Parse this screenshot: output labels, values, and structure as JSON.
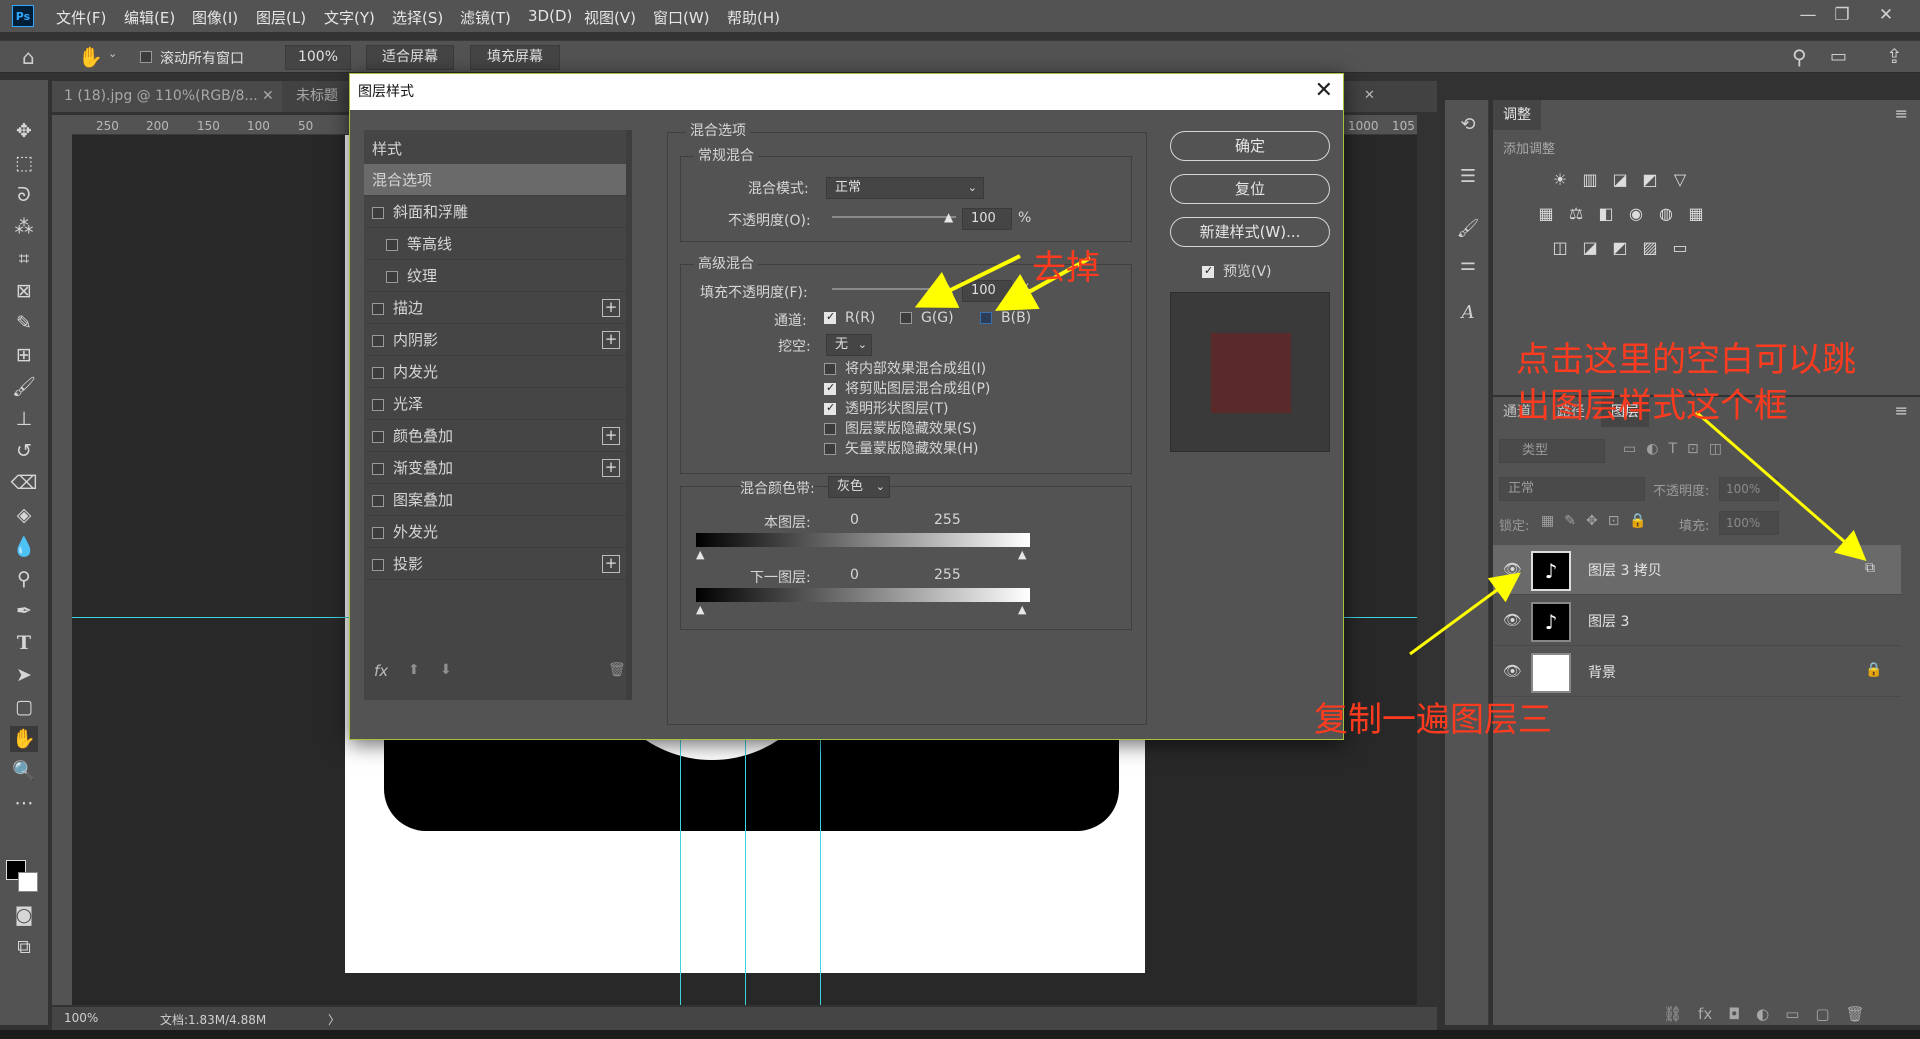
{
  "menubar": {
    "logo": "Ps",
    "items": [
      "文件(F)",
      "编辑(E)",
      "图像(I)",
      "图层(L)",
      "文字(Y)",
      "选择(S)",
      "滤镜(T)",
      "3D(D)",
      "视图(V)",
      "窗口(W)",
      "帮助(H)"
    ],
    "window_buttons": [
      "—",
      "❐",
      "✕"
    ]
  },
  "options": {
    "scroll_all_label": "滚动所有窗口",
    "zoom_value": "100%",
    "fit_screen": "适合屏幕",
    "fill_screen": "填充屏幕"
  },
  "doc_tabs": [
    {
      "label": "1 (18).jpg @ 110%(RGB/8...",
      "close": "✕"
    },
    {
      "label": "未标题",
      "close": ""
    }
  ],
  "doc_tab_extra_close": "✕",
  "ruler": {
    "h_ticks": [
      "250",
      "200",
      "150",
      "100",
      "50",
      "1000",
      "105"
    ]
  },
  "status": {
    "zoom": "100%",
    "doc_info": "文档:1.83M/4.88M",
    "arrow": "〉"
  },
  "adjust_panel": {
    "tab": "调整",
    "add_label": "添加调整",
    "icons_row1": [
      "☀",
      "▥",
      "◪",
      "◩",
      "▽"
    ],
    "icons_row2": [
      "▦",
      "⚖",
      "◧",
      "◉",
      "◍",
      "▦"
    ],
    "icons_row3": [
      "◫",
      "◪",
      "◩",
      "▨",
      "▭"
    ]
  },
  "layers_panel": {
    "tabs": [
      "通道",
      "路径",
      "图层"
    ],
    "filter_type": "类型",
    "blend_mode": "正常",
    "opacity_label": "不透明度:",
    "opacity_value": "100%",
    "lock_label": "锁定:",
    "fill_label": "填充:",
    "fill_value": "100%",
    "layers": [
      {
        "name": "图层 3 拷贝",
        "selected": true,
        "thumb": "tiktok"
      },
      {
        "name": "图层 3",
        "selected": false,
        "thumb": "tiktok"
      },
      {
        "name": "背景",
        "selected": false,
        "thumb": "white"
      }
    ],
    "footer_icons": [
      "⛓",
      "fx",
      "◘",
      "◐",
      "▭",
      "▢",
      "🗑"
    ]
  },
  "dialog": {
    "title": "图层样式",
    "close": "✕",
    "styles_header": "样式",
    "style_items": [
      {
        "label": "混合选项",
        "check": false,
        "plus": false,
        "indent": false,
        "active": true,
        "nocheck": true
      },
      {
        "label": "斜面和浮雕",
        "check": false,
        "plus": false,
        "indent": false
      },
      {
        "label": "等高线",
        "check": false,
        "plus": false,
        "indent": true
      },
      {
        "label": "纹理",
        "check": false,
        "plus": false,
        "indent": true
      },
      {
        "label": "描边",
        "check": false,
        "plus": true,
        "indent": false
      },
      {
        "label": "内阴影",
        "check": false,
        "plus": true,
        "indent": false
      },
      {
        "label": "内发光",
        "check": false,
        "plus": false,
        "indent": false
      },
      {
        "label": "光泽",
        "check": false,
        "plus": false,
        "indent": false
      },
      {
        "label": "颜色叠加",
        "check": false,
        "plus": true,
        "indent": false
      },
      {
        "label": "渐变叠加",
        "check": false,
        "plus": true,
        "indent": false
      },
      {
        "label": "图案叠加",
        "check": false,
        "plus": false,
        "indent": false
      },
      {
        "label": "外发光",
        "check": false,
        "plus": false,
        "indent": false
      },
      {
        "label": "投影",
        "check": false,
        "plus": true,
        "indent": false
      }
    ],
    "footer": {
      "fx": "fx",
      "up": "⬆",
      "down": "⬇",
      "trash": "🗑"
    },
    "blend": {
      "section": "混合选项",
      "general": "常规混合",
      "mode_label": "混合模式:",
      "mode_value": "正常",
      "opacity_label": "不透明度(O):",
      "opacity_value": "100",
      "pct": "%",
      "advanced": "高级混合",
      "fill_label": "填充不透明度(F):",
      "fill_value": "100",
      "channels_label": "通道:",
      "channels": [
        {
          "label": "R(R)",
          "checked": true
        },
        {
          "label": "G(G)",
          "checked": false
        },
        {
          "label": "B(B)",
          "checked": false
        }
      ],
      "knockout_label": "挖空:",
      "knockout_value": "无",
      "options": [
        {
          "label": "将内部效果混合成组(I)",
          "checked": false
        },
        {
          "label": "将剪贴图层混合成组(P)",
          "checked": true
        },
        {
          "label": "透明形状图层(T)",
          "checked": true
        },
        {
          "label": "图层蒙版隐藏效果(S)",
          "checked": false
        },
        {
          "label": "矢量蒙版隐藏效果(H)",
          "checked": false
        }
      ],
      "blend_if_label": "混合颜色带:",
      "blend_if_value": "灰色",
      "this_layer": "本图层:",
      "under_layer": "下一图层:",
      "range_min": "0",
      "range_max": "255"
    },
    "buttons": {
      "ok": "确定",
      "reset": "复位",
      "new_style": "新建样式(W)...",
      "preview": "预览(V)"
    },
    "preview_color": "#5a2a2a"
  },
  "annotations": {
    "remove": "去掉",
    "click_blank_line1": "点击这里的空白可以跳",
    "click_blank_line2": "出图层样式这个框",
    "duplicate": "复制一遍图层三"
  },
  "colors": {
    "annotation_red": "#ff3b1f",
    "arrow_yellow": "#ffff00",
    "guide_cyan": "#3fd3e0"
  }
}
